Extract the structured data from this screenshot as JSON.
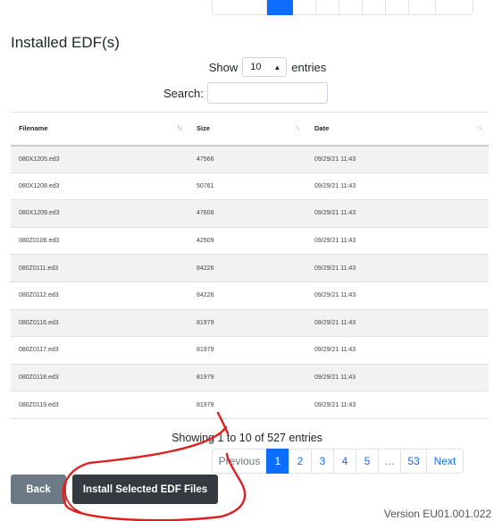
{
  "section_title": "Installed EDF(s)",
  "length_control": {
    "prefix": "Show",
    "selected": "10",
    "suffix": "entries"
  },
  "search": {
    "label": "Search:",
    "value": ""
  },
  "table": {
    "columns": [
      "Filename",
      "Size",
      "Date"
    ],
    "rows": [
      [
        "080X1205.ed3",
        "47566",
        "09/29/21 11:43"
      ],
      [
        "080X1208.ed3",
        "50761",
        "09/29/21 11:43"
      ],
      [
        "080X1209.ed3",
        "47608",
        "09/29/21 11:43"
      ],
      [
        "080Z0106.ed3",
        "42509",
        "09/29/21 11:43"
      ],
      [
        "080Z0111.ed3",
        "84226",
        "09/29/21 11:43"
      ],
      [
        "080Z0112.ed3",
        "84226",
        "09/29/21 11:43"
      ],
      [
        "080Z0116.ed3",
        "81979",
        "09/29/21 11:43"
      ],
      [
        "080Z0117.ed3",
        "81979",
        "09/29/21 11:43"
      ],
      [
        "080Z0118.ed3",
        "81979",
        "09/29/21 11:43"
      ],
      [
        "080Z0119.ed3",
        "81979",
        "09/29/21 11:43"
      ]
    ]
  },
  "info_text": "Showing 1 to 10 of 527 entries",
  "pagination": {
    "previous": "Previous",
    "pages": [
      "1",
      "2",
      "3",
      "4",
      "5"
    ],
    "ellipsis": "…",
    "last": "53",
    "next": "Next",
    "active": "1"
  },
  "buttons": {
    "back": "Back",
    "install": "Install Selected EDF Files"
  },
  "version": "Version EU01.001.022",
  "colors": {
    "primary": "#0d6efd",
    "annotation": "#e02020",
    "install_bg": "#343a40",
    "back_bg": "#6c7a86"
  }
}
